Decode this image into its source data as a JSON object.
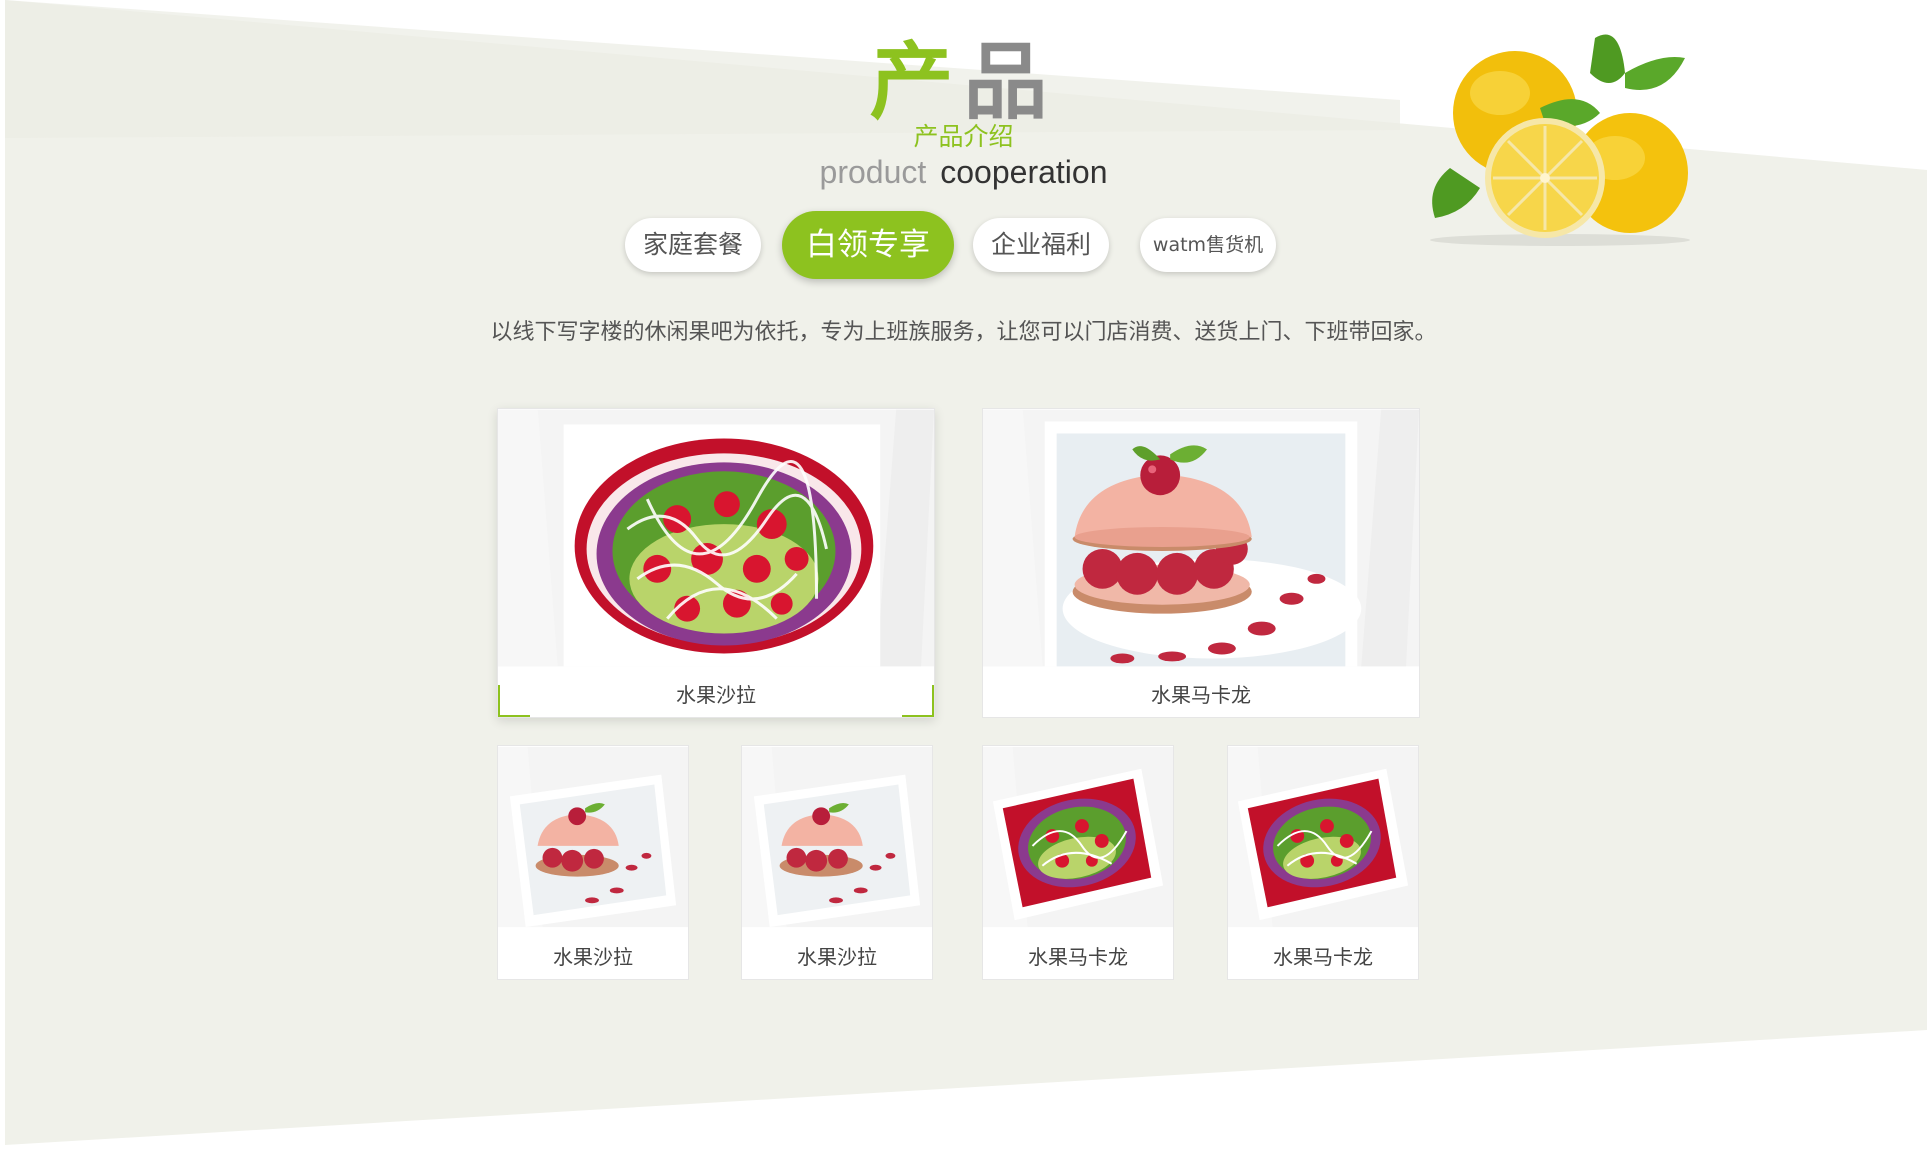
{
  "header": {
    "title_part1": "产",
    "title_part2": "品",
    "subtitle": "产品介绍",
    "eng_part1": "product",
    "eng_part2": "cooperation"
  },
  "tabs": [
    {
      "label": "家庭套餐",
      "active": false
    },
    {
      "label": "白领专享",
      "active": true
    },
    {
      "label": "企业福利",
      "active": false
    },
    {
      "label": "watm售货机",
      "active": false
    }
  ],
  "description": "以线下写字楼的休闲果吧为依托，专为上班族服务，让您可以门店消费、送货上门、下班带回家。",
  "products_large": [
    {
      "name": "水果沙拉",
      "image": "fruit-salad"
    },
    {
      "name": "水果马卡龙",
      "image": "raspberry-macaron"
    }
  ],
  "products_small": [
    {
      "name": "水果沙拉",
      "image": "raspberry-macaron"
    },
    {
      "name": "水果沙拉",
      "image": "raspberry-macaron"
    },
    {
      "name": "水果马卡龙",
      "image": "fruit-salad"
    },
    {
      "name": "水果马卡龙",
      "image": "fruit-salad"
    }
  ],
  "colors": {
    "accent": "#8dc21f",
    "background_band": "#f0f1ea",
    "text": "#555555"
  }
}
